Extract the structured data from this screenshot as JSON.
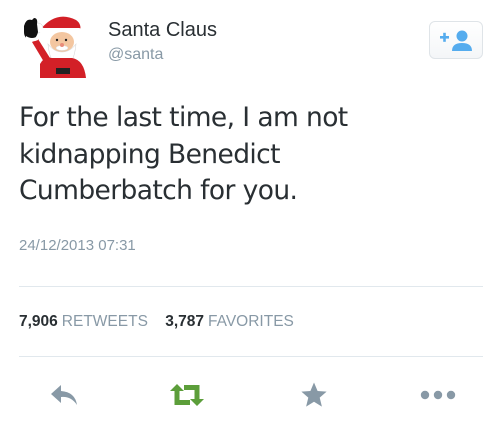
{
  "tweet": {
    "author": {
      "display_name": "Santa Claus",
      "handle": "@santa",
      "avatar_icon": "santa-avatar"
    },
    "follow_button_icon": "add-user-icon",
    "text_lines": [
      "For the last time, I am not",
      "kidnapping  Benedict",
      "Cumberbatch for you."
    ],
    "timestamp": "24/12/2013 07:31",
    "stats": {
      "retweets_count": "7,906",
      "retweets_label": "RETWEETS",
      "favorites_count": "3,787",
      "favorites_label": "FAVORITES"
    },
    "actions": [
      "reply-icon",
      "retweet-icon",
      "star-icon",
      "more-icon"
    ]
  },
  "colors": {
    "text": "#292f33",
    "muted": "#8899a6",
    "retweet_green": "#5c9e3a",
    "icon_gray": "#8899a6",
    "follow_blue": "#55acee"
  }
}
